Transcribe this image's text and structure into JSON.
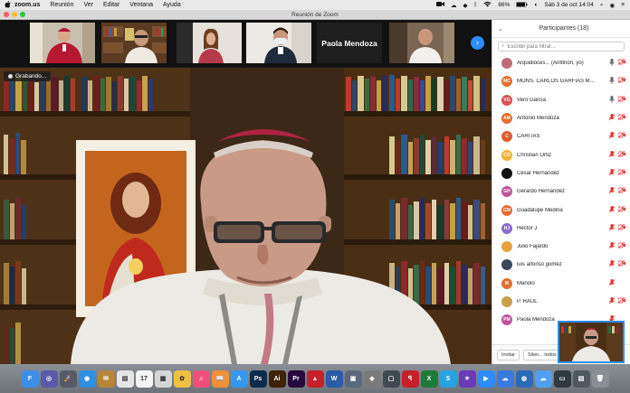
{
  "menubar": {
    "apple": "",
    "app": "zoom.us",
    "items": [
      "Reunión",
      "Ver",
      "Editar",
      "Ventana",
      "Ayuda"
    ],
    "battery": "86%",
    "clock": "Sáb 3 de oct  14:04"
  },
  "window": {
    "title": "Reunión de Zoom"
  },
  "thumbnails": {
    "name_tile": "Paola Mendoza",
    "next": "›"
  },
  "recording": {
    "label": "Grabando..."
  },
  "participants": {
    "header": "Participantes (18)",
    "search_placeholder": "Escribir para filtrar...",
    "list": [
      {
        "name": "Arquidióces... (Anfitrión, yo)",
        "initials": "",
        "color": "#c06a7a",
        "mic": "on",
        "video": "off"
      },
      {
        "name": "MONS. CARLOS GARFIAS M...",
        "initials": "MC",
        "color": "#e46d2e",
        "mic": "on",
        "video": "off"
      },
      {
        "name": "Vero García",
        "initials": "VG",
        "color": "#d9534f",
        "mic": "on",
        "video": "off"
      },
      {
        "name": "Antonio Mendoza",
        "initials": "AM",
        "color": "#e46d2e",
        "mic": "off",
        "video": "off"
      },
      {
        "name": "CARITAS",
        "initials": "C",
        "color": "#e05a2b",
        "mic": "off",
        "video": "off"
      },
      {
        "name": "Christian Ortiz",
        "initials": "CO",
        "color": "#f2b233",
        "mic": "off",
        "video": "off"
      },
      {
        "name": "César Hernández",
        "initials": "",
        "color": "#111111",
        "mic": "off",
        "video": "off"
      },
      {
        "name": "Gerardo Hernández",
        "initials": "GH",
        "color": "#c0529a",
        "mic": "off",
        "video": "off"
      },
      {
        "name": "Guadalupe Medina",
        "initials": "GM",
        "color": "#e46d2e",
        "mic": "off",
        "video": "off"
      },
      {
        "name": "Héctor J",
        "initials": "HJ",
        "color": "#8a6cc9",
        "mic": "off",
        "video": "off"
      },
      {
        "name": "Julio Fajardo",
        "initials": "",
        "color": "#e8a23c",
        "mic": "off",
        "video": "off"
      },
      {
        "name": "luis alfonso gomez",
        "initials": "",
        "color": "#3a4a5a",
        "mic": "off",
        "video": "off"
      },
      {
        "name": "Manolo",
        "initials": "M",
        "color": "#e46d2e",
        "mic": "off",
        "video": "none"
      },
      {
        "name": "P. RAÚL",
        "initials": "",
        "color": "#c9a04a",
        "mic": "off",
        "video": "off"
      },
      {
        "name": "Paola Mendoza",
        "initials": "PM",
        "color": "#c0529a",
        "mic": "off",
        "video": "none"
      }
    ],
    "footer": {
      "invite": "Invitar",
      "mute_all": "Silen... todos"
    }
  },
  "dock": {
    "apps": [
      {
        "label": "F",
        "color": "#3d8ee8"
      },
      {
        "label": "◎",
        "color": "#5a5aa8"
      },
      {
        "label": "🚀",
        "color": "#555a66"
      },
      {
        "label": "◉",
        "color": "#2f8fe0"
      },
      {
        "label": "✉",
        "color": "#b8863a"
      },
      {
        "label": "▤",
        "color": "#e6e6e6"
      },
      {
        "label": "17",
        "color": "#f4f4f4"
      },
      {
        "label": "▦",
        "color": "#d6d6d6"
      },
      {
        "label": "✿",
        "color": "#f0c040"
      },
      {
        "label": "♫",
        "color": "#f04f7a"
      },
      {
        "label": "📖",
        "color": "#f0923a"
      },
      {
        "label": "A",
        "color": "#3597f0"
      },
      {
        "label": "Ps",
        "color": "#0d2b4a"
      },
      {
        "label": "Ai",
        "color": "#3d2205"
      },
      {
        "label": "Pr",
        "color": "#26083e"
      },
      {
        "label": "▲",
        "color": "#c8202a"
      },
      {
        "label": "W",
        "color": "#2b5aa8"
      },
      {
        "label": "▣",
        "color": "#5a6a7a"
      },
      {
        "label": "◈",
        "color": "#7a7a7a"
      },
      {
        "label": "▢",
        "color": "#404850"
      },
      {
        "label": "ꟼ",
        "color": "#c8202a"
      },
      {
        "label": "X",
        "color": "#1f7a3a"
      },
      {
        "label": "S",
        "color": "#26a3e0"
      },
      {
        "label": "✶",
        "color": "#6a3ab8"
      },
      {
        "label": "▶",
        "color": "#2d8cff"
      },
      {
        "label": "☁",
        "color": "#3a7ae0"
      },
      {
        "label": "◍",
        "color": "#2a6ab8"
      },
      {
        "label": "☁",
        "color": "#50a0f0"
      },
      {
        "label": "▭",
        "color": "#303840"
      },
      {
        "label": "▤",
        "color": "#505860"
      },
      {
        "label": "🗑",
        "color": "#8a8f96"
      }
    ]
  }
}
